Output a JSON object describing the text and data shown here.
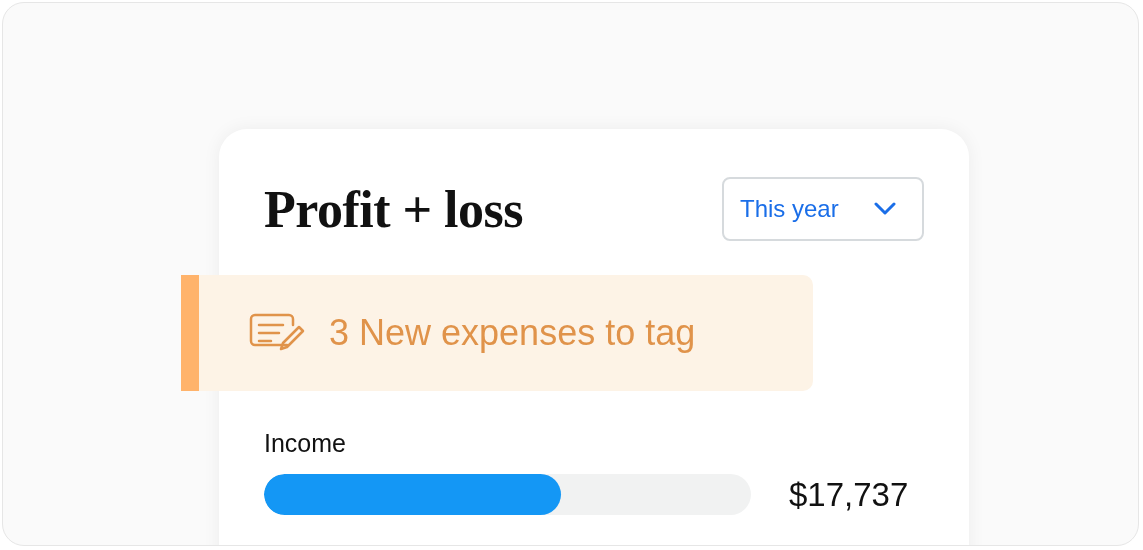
{
  "card": {
    "title": "Profit + loss",
    "period_dropdown": {
      "value": "This year"
    },
    "notice": {
      "text": "3 New expenses to tag"
    },
    "metrics": [
      {
        "label": "Income",
        "level": 0.61,
        "amount": "$17,737"
      }
    ]
  }
}
